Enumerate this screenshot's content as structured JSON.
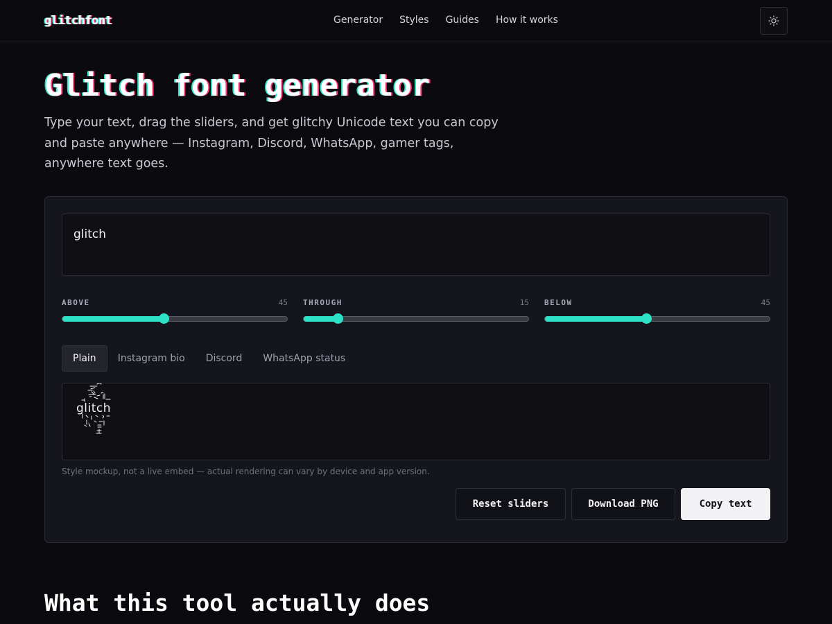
{
  "brand": {
    "logo": "glitchfont"
  },
  "nav": {
    "items": [
      "Generator",
      "Styles",
      "Guides",
      "How it works"
    ]
  },
  "hero": {
    "title": "Glitch font generator",
    "description": "Type your text, drag the sliders, and get glitchy Unicode text you can copy and paste anywhere — Instagram, Discord, WhatsApp, gamer tags, anywhere text goes."
  },
  "input": {
    "value": "glitch"
  },
  "sliders": [
    {
      "label": "ABOVE",
      "value": 45,
      "max": 100
    },
    {
      "label": "THROUGH",
      "value": 15,
      "max": 100
    },
    {
      "label": "BELOW",
      "value": 45,
      "max": 100
    }
  ],
  "tabs": [
    "Plain",
    "Instagram bio",
    "Discord",
    "WhatsApp status"
  ],
  "active_tab": "Plain",
  "preview": {
    "text": "glitch"
  },
  "note": "Style mockup, not a live embed — actual rendering can vary by device and app version.",
  "buttons": {
    "reset": "Reset sliders",
    "download": "Download PNG",
    "copy": "Copy text"
  },
  "section": {
    "title": "What this tool actually does"
  },
  "colors": {
    "accent": "#2de2c6",
    "glitch_red": "#ff3d7f",
    "background": "#0b0b0f",
    "panel": "#15161d"
  },
  "icons": {
    "theme_toggle": "sun-icon"
  }
}
